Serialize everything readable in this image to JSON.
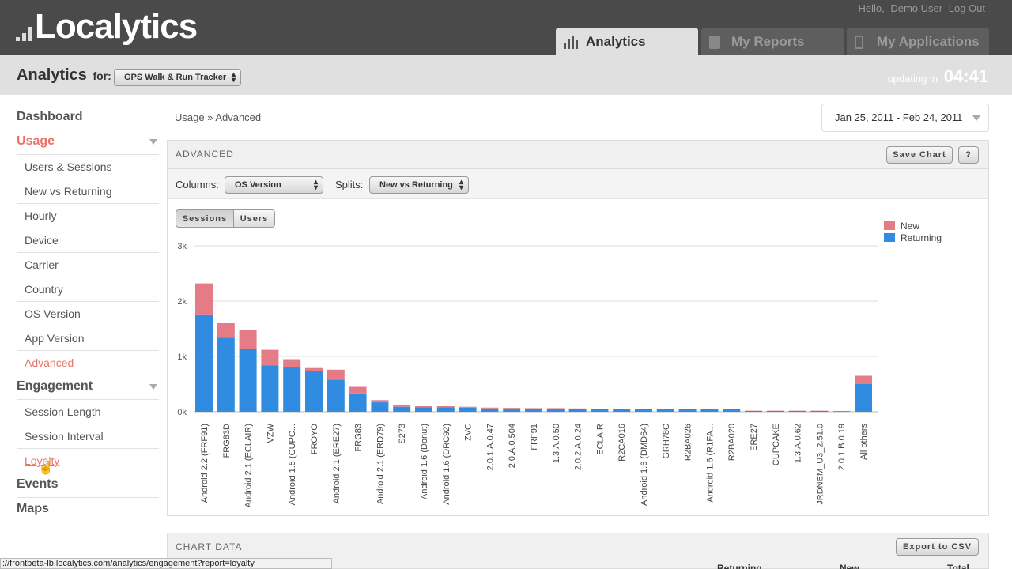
{
  "brand": {
    "name": "Localytics"
  },
  "user": {
    "greeting": "Hello,",
    "name": "Demo User",
    "logout": "Log Out"
  },
  "tabs": [
    {
      "label": "Analytics",
      "active": true,
      "icon": "bar-chart-icon"
    },
    {
      "label": "My Reports",
      "active": false,
      "icon": "document-icon"
    },
    {
      "label": "My Applications",
      "active": false,
      "icon": "phone-icon"
    }
  ],
  "subheader": {
    "title": "Analytics",
    "for_label": "for:",
    "app_selected": "GPS Walk & Run Tracker",
    "updating_label": "updating in",
    "countdown": "04:41"
  },
  "sidebar": {
    "sections": [
      {
        "label": "Dashboard",
        "active": false,
        "items": []
      },
      {
        "label": "Usage",
        "active": true,
        "expandable": true,
        "items": [
          "Users & Sessions",
          "New vs Returning",
          "Hourly",
          "Device",
          "Carrier",
          "Country",
          "OS Version",
          "App Version",
          "Advanced"
        ],
        "active_item": "Advanced"
      },
      {
        "label": "Engagement",
        "active": false,
        "expandable": true,
        "items": [
          "Session Length",
          "Session Interval",
          "Loyalty"
        ],
        "hover_item": "Loyalty"
      },
      {
        "label": "Events",
        "active": false,
        "items": []
      },
      {
        "label": "Maps",
        "active": false,
        "items": []
      }
    ]
  },
  "breadcrumb": "Usage » Advanced",
  "date_range": "Jan 25, 2011 - Feb 24, 2011",
  "panel": {
    "title": "ADVANCED",
    "save_chart": "Save Chart",
    "help": "?",
    "columns_label": "Columns:",
    "columns_value": "OS Version",
    "splits_label": "Splits:",
    "splits_value": "New vs Returning",
    "toggle": [
      "Sessions",
      "Users"
    ],
    "toggle_active": "Sessions"
  },
  "colors": {
    "new": "#e57b87",
    "returning": "#2f8ce0",
    "accent": "#e8756a"
  },
  "chart_data": {
    "type": "bar",
    "stacked": true,
    "categories": [
      "Android 2.2 (FRF91)",
      "FRG83D",
      "Android 2.1 (ECLAIR)",
      "VZW",
      "Android 1.5 (CUPC...",
      "FROYO",
      "Android 2.1 (ERE27)",
      "FRG83",
      "Android 2.1 (ERD79)",
      "S273",
      "Android 1.6 (Donut)",
      "Android 1.6 (DRC92)",
      "ZVC",
      "2.0.1.A.0.47",
      "2.0.A.0.504",
      "FRF91",
      "1.3.A.0.50",
      "2.0.2.A.0.24",
      "ECLAIR",
      "R2CA016",
      "Android 1.6 (DMD64)",
      "GRH78C",
      "R2BA026",
      "Android 1.6 (R1FA...",
      "R2BA020",
      "ERE27",
      "CUPCAKE",
      "1.3.A.0.62",
      "JRDNEM_U3_2.51.0",
      "2.0.1.B.0.19",
      "All others"
    ],
    "series": [
      {
        "name": "Returning",
        "values": [
          1760,
          1340,
          1140,
          840,
          800,
          740,
          580,
          330,
          170,
          90,
          80,
          80,
          75,
          60,
          60,
          55,
          55,
          50,
          45,
          45,
          45,
          45,
          45,
          45,
          45,
          15,
          15,
          15,
          15,
          10,
          500
        ]
      },
      {
        "name": "New",
        "values": [
          560,
          260,
          340,
          280,
          150,
          50,
          180,
          120,
          40,
          25,
          20,
          20,
          15,
          15,
          10,
          10,
          10,
          10,
          10,
          5,
          5,
          5,
          5,
          5,
          5,
          5,
          5,
          5,
          5,
          5,
          150
        ]
      }
    ],
    "yticks": [
      "0k",
      "1k",
      "2k",
      "3k"
    ],
    "ylim": [
      0,
      3000
    ],
    "legend_position": "top-right",
    "grid": true
  },
  "chart_data_panel": {
    "title": "CHART DATA",
    "export": "Export to CSV"
  },
  "table_headers_partial": [
    "Returning",
    "New",
    "Total"
  ],
  "status_url": "://frontbeta-lb.localytics.com/analytics/engagement?report=loyalty"
}
